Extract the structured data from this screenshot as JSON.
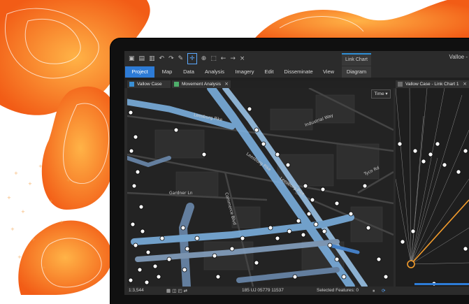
{
  "app": {
    "window_title": "Valloe - "
  },
  "contextual_tab": {
    "label": "Link Chart"
  },
  "ribbon": {
    "tabs": [
      "Project",
      "Map",
      "Data",
      "Analysis",
      "Imagery",
      "Edit",
      "Disseminate",
      "View",
      "Diagram"
    ],
    "active_tab": "Project"
  },
  "view_tabs": {
    "map_tab": "Vallow Case",
    "analysis_tab": "Movement Analysis",
    "chart_tab": "Vallow Case - Link Chart 1"
  },
  "map": {
    "time_button": "Time",
    "road_labels": [
      "Leesburg Pike",
      "Leesburg Pike",
      "Industrial Way",
      "Tyco Rd",
      "Leesburg Pike",
      "Gardner Ln",
      "Commerce Blvd"
    ]
  },
  "status": {
    "scale": "1:3,544",
    "coordinates": "185 UJ 05779 11537",
    "selected": "Selected Features: 0"
  },
  "colors": {
    "accent": "#2d7bd6",
    "track": "#7fb6e8",
    "heat": "#f7641b",
    "link": "#f39c2c"
  }
}
